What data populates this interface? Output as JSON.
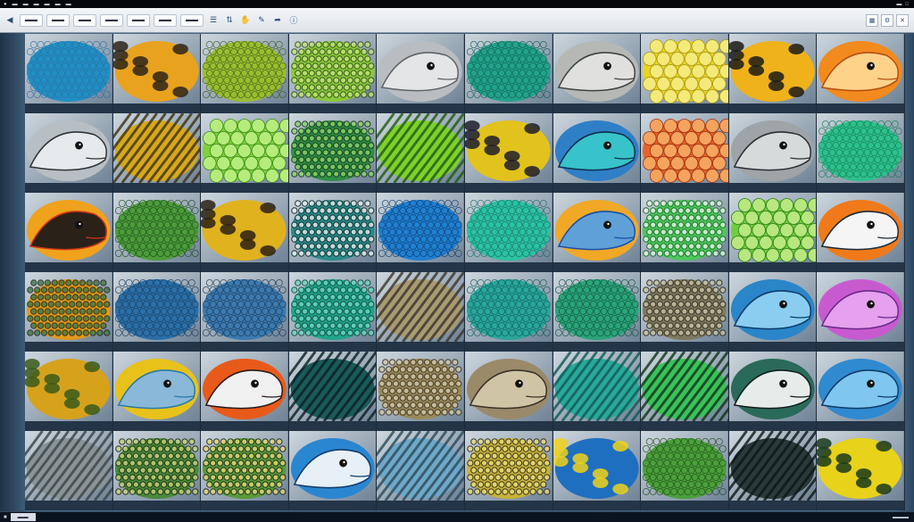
{
  "colors": {
    "menubar_bg": "#05070a",
    "toolbar_bg": "#e6eaef",
    "workspace_bg": "#3e5c78",
    "caption_bg": "#233547"
  },
  "toolbar": {
    "icons": [
      "list-view-icon",
      "sort-icon",
      "hand-icon",
      "pen-icon",
      "share-icon",
      "info-icon"
    ]
  },
  "thumbnails": [
    {
      "palette": [
        "#1f8fc4",
        "#2e6fa0",
        "#9ccde6"
      ],
      "pattern": "scales"
    },
    {
      "palette": [
        "#e8a21e",
        "#2d2418",
        "#7a6b4a"
      ],
      "pattern": "blotch"
    },
    {
      "palette": [
        "#9bbd2f",
        "#3a5d1a",
        "#d4d88a"
      ],
      "pattern": "scales"
    },
    {
      "palette": [
        "#8cc83a",
        "#2d4f1d",
        "#c5e27a"
      ],
      "pattern": "net"
    },
    {
      "palette": [
        "#b9bdc1",
        "#5e6366",
        "#e3e5e6"
      ],
      "pattern": "head"
    },
    {
      "palette": [
        "#22a28a",
        "#0f5e55",
        "#6fd2bd"
      ],
      "pattern": "scales"
    },
    {
      "palette": [
        "#b6b8b5",
        "#3f4340",
        "#e0e1df"
      ],
      "pattern": "head"
    },
    {
      "palette": [
        "#e8d421",
        "#a89516",
        "#f4ea7a"
      ],
      "pattern": "bubbles"
    },
    {
      "palette": [
        "#f0b21a",
        "#1b1a16",
        "#8a7a3a"
      ],
      "pattern": "blotch"
    },
    {
      "palette": [
        "#f28a1e",
        "#b44e10",
        "#ffd28a"
      ],
      "pattern": "head"
    },
    {
      "palette": [
        "#b7bfc4",
        "#2d3336",
        "#e6eaec"
      ],
      "pattern": "head"
    },
    {
      "palette": [
        "#d6a81c",
        "#3c2f11",
        "#91a330"
      ],
      "pattern": "stripes"
    },
    {
      "palette": [
        "#7fd03a",
        "#3c8a1d",
        "#b6ec7c"
      ],
      "pattern": "bubbles"
    },
    {
      "palette": [
        "#2f8f45",
        "#14331b",
        "#8cd26a"
      ],
      "pattern": "net"
    },
    {
      "palette": [
        "#7ed12a",
        "#1f5a14",
        "#cff08a"
      ],
      "pattern": "stripes"
    },
    {
      "palette": [
        "#e2c21c",
        "#1d1d2a",
        "#3a63b5"
      ],
      "pattern": "blotch"
    },
    {
      "palette": [
        "#2f7fc7",
        "#0f2e4d",
        "#37c3c9"
      ],
      "pattern": "head"
    },
    {
      "palette": [
        "#e86228",
        "#9b2f12",
        "#f4a45e"
      ],
      "pattern": "bubbles"
    },
    {
      "palette": [
        "#9ea4a7",
        "#2a2f32",
        "#d7dadb"
      ],
      "pattern": "head"
    },
    {
      "palette": [
        "#2dc08c",
        "#127a54",
        "#8df0c6"
      ],
      "pattern": "scales"
    },
    {
      "palette": [
        "#f0a21c",
        "#d0351a",
        "#2a2218"
      ],
      "pattern": "head"
    },
    {
      "palette": [
        "#4c9c3a",
        "#1d4a1a",
        "#9fd27c"
      ],
      "pattern": "scales"
    },
    {
      "palette": [
        "#e0b21d",
        "#2a2012",
        "#a88a1a"
      ],
      "pattern": "blotch"
    },
    {
      "palette": [
        "#2a8a8a",
        "#0e2a2a",
        "#e6eef0"
      ],
      "pattern": "net"
    },
    {
      "palette": [
        "#1f7fd0",
        "#0d3a6e",
        "#52b6f0"
      ],
      "pattern": "scales"
    },
    {
      "palette": [
        "#2ac2a0",
        "#1a6c6a",
        "#9ff0de"
      ],
      "pattern": "scales"
    },
    {
      "palette": [
        "#f0a826",
        "#1a4fa8",
        "#5fa0d8"
      ],
      "pattern": "head"
    },
    {
      "palette": [
        "#4cc85a",
        "#1a6a2a",
        "#e6f4e6"
      ],
      "pattern": "net"
    },
    {
      "palette": [
        "#6fcf3a",
        "#2a7a1a",
        "#b7e77e"
      ],
      "pattern": "bubbles"
    },
    {
      "palette": [
        "#f07a1a",
        "#1a2a3a",
        "#f5f5f5"
      ],
      "pattern": "head"
    },
    {
      "palette": [
        "#e09a1a",
        "#2a2418",
        "#3b7c4a"
      ],
      "pattern": "net"
    },
    {
      "palette": [
        "#2a6fa8",
        "#1a3a5a",
        "#6fb0d8"
      ],
      "pattern": "scales"
    },
    {
      "palette": [
        "#3a7ab0",
        "#1a3550",
        "#8ab8d8"
      ],
      "pattern": "scales"
    },
    {
      "palette": [
        "#1fa58a",
        "#0f4a40",
        "#6fd6c0"
      ],
      "pattern": "net"
    },
    {
      "palette": [
        "#a89a72",
        "#3a342a",
        "#d6cfb6"
      ],
      "pattern": "stripes"
    },
    {
      "palette": [
        "#28a69a",
        "#0f5a58",
        "#80d8cf"
      ],
      "pattern": "scales"
    },
    {
      "palette": [
        "#2aa47a",
        "#0f4f3a",
        "#7ad6ae"
      ],
      "pattern": "scales"
    },
    {
      "palette": [
        "#7f7a5e",
        "#2c2a22",
        "#c8c2a2"
      ],
      "pattern": "net"
    },
    {
      "palette": [
        "#2a86c8",
        "#0e3b66",
        "#8acdf0"
      ],
      "pattern": "head"
    },
    {
      "palette": [
        "#c85ad0",
        "#6a2a8a",
        "#e6a0ee"
      ],
      "pattern": "head"
    },
    {
      "palette": [
        "#d6a21c",
        "#3a5a1a",
        "#e8c84a"
      ],
      "pattern": "blotch"
    },
    {
      "palette": [
        "#e8c21a",
        "#2a7aa8",
        "#8ab8d8"
      ],
      "pattern": "head"
    },
    {
      "palette": [
        "#e85a1a",
        "#2a1a1a",
        "#f0f0f0"
      ],
      "pattern": "head"
    },
    {
      "palette": [
        "#1a5a5a",
        "#0a1f22",
        "#e6f0f0"
      ],
      "pattern": "stripes"
    },
    {
      "palette": [
        "#9a8a5a",
        "#3a3020",
        "#d0c8a8"
      ],
      "pattern": "net"
    },
    {
      "palette": [
        "#9a8a6a",
        "#3a3226",
        "#cfc4a6"
      ],
      "pattern": "head"
    },
    {
      "palette": [
        "#2aa89a",
        "#0f5a55",
        "#7fdcd2"
      ],
      "pattern": "stripes"
    },
    {
      "palette": [
        "#3ac25a",
        "#10331a",
        "#9ff0b0"
      ],
      "pattern": "stripes"
    },
    {
      "palette": [
        "#2a6a5a",
        "#0f1f1c",
        "#e6ecea"
      ],
      "pattern": "head"
    },
    {
      "palette": [
        "#2f8ad0",
        "#0f3c66",
        "#7fc6f0"
      ],
      "pattern": "head"
    },
    {
      "palette": [
        "#8a9498",
        "#3a4246",
        "#c6ccce"
      ],
      "pattern": "stripes"
    },
    {
      "palette": [
        "#4a8a3a",
        "#1a2a14",
        "#c8d27a"
      ],
      "pattern": "net"
    },
    {
      "palette": [
        "#5a9a3a",
        "#1a2818",
        "#e6d87a"
      ],
      "pattern": "net"
    },
    {
      "palette": [
        "#2a86d0",
        "#0f3a6a",
        "#e6f0f6"
      ],
      "pattern": "head"
    },
    {
      "palette": [
        "#6fa8c8",
        "#2a4a5a",
        "#c6dcea"
      ],
      "pattern": "stripes"
    },
    {
      "palette": [
        "#c8b23a",
        "#2a2a1a",
        "#e8dc7a"
      ],
      "pattern": "net"
    },
    {
      "palette": [
        "#1f6fc0",
        "#f0d21a",
        "#0f2a4a"
      ],
      "pattern": "blotch"
    },
    {
      "palette": [
        "#4aa03a",
        "#1f4a1a",
        "#9fd07a"
      ],
      "pattern": "scales"
    },
    {
      "palette": [
        "#2a3a3a",
        "#0f1616",
        "#9aa8a8"
      ],
      "pattern": "stripes"
    },
    {
      "palette": [
        "#e8d21a",
        "#1a3a1a",
        "#4a9a3a"
      ],
      "pattern": "blotch"
    }
  ]
}
